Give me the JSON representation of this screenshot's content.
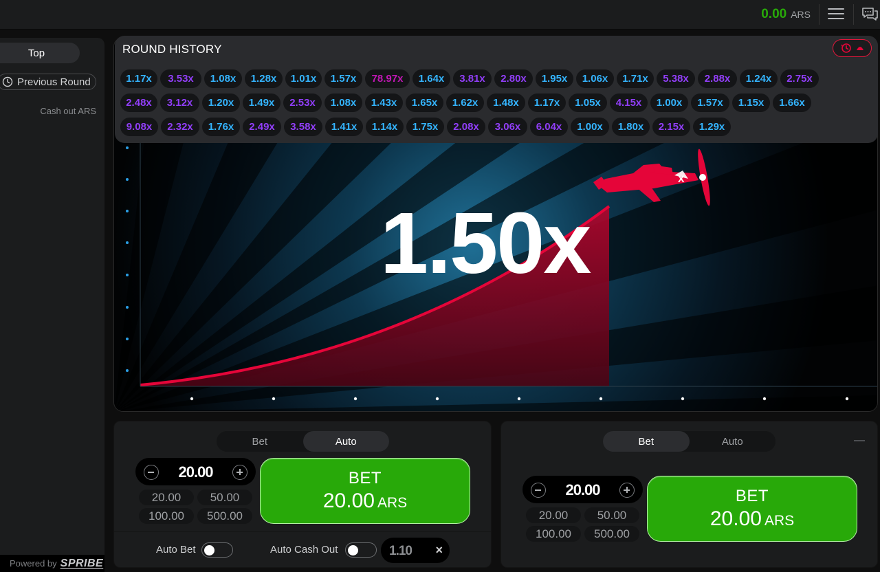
{
  "header": {
    "balance_amount": "0.00",
    "balance_currency": "ARS",
    "menu_icon": "hamburger-menu-icon",
    "chat_icon": "chat-icon"
  },
  "left_panel": {
    "tab_top": "Top",
    "previous_round": "Previous Round",
    "cashout_label": "Cash out ARS",
    "powered_by": "Powered by",
    "brand": "SPRIBE"
  },
  "history": {
    "title": "ROUND HISTORY",
    "rows": [
      [
        {
          "v": "1.17x",
          "c": "blue"
        },
        {
          "v": "3.53x",
          "c": "purple"
        },
        {
          "v": "1.08x",
          "c": "blue"
        },
        {
          "v": "1.28x",
          "c": "blue"
        },
        {
          "v": "1.01x",
          "c": "blue"
        },
        {
          "v": "1.57x",
          "c": "blue"
        },
        {
          "v": "78.97x",
          "c": "pink"
        },
        {
          "v": "1.64x",
          "c": "blue"
        },
        {
          "v": "3.81x",
          "c": "purple"
        },
        {
          "v": "2.80x",
          "c": "purple"
        },
        {
          "v": "1.95x",
          "c": "blue"
        },
        {
          "v": "1.06x",
          "c": "blue"
        },
        {
          "v": "1.71x",
          "c": "blue"
        },
        {
          "v": "5.38x",
          "c": "purple"
        },
        {
          "v": "2.88x",
          "c": "purple"
        },
        {
          "v": "1.24x",
          "c": "blue"
        },
        {
          "v": "2.75x",
          "c": "purple"
        }
      ],
      [
        {
          "v": "2.48x",
          "c": "purple"
        },
        {
          "v": "3.12x",
          "c": "purple"
        },
        {
          "v": "1.20x",
          "c": "blue"
        },
        {
          "v": "1.49x",
          "c": "blue"
        },
        {
          "v": "2.53x",
          "c": "purple"
        },
        {
          "v": "1.08x",
          "c": "blue"
        },
        {
          "v": "1.43x",
          "c": "blue"
        },
        {
          "v": "1.65x",
          "c": "blue"
        },
        {
          "v": "1.62x",
          "c": "blue"
        },
        {
          "v": "1.48x",
          "c": "blue"
        },
        {
          "v": "1.17x",
          "c": "blue"
        },
        {
          "v": "1.05x",
          "c": "blue"
        },
        {
          "v": "4.15x",
          "c": "purple"
        },
        {
          "v": "1.00x",
          "c": "blue"
        },
        {
          "v": "1.57x",
          "c": "blue"
        },
        {
          "v": "1.15x",
          "c": "blue"
        },
        {
          "v": "1.66x",
          "c": "blue"
        }
      ],
      [
        {
          "v": "9.08x",
          "c": "purple"
        },
        {
          "v": "2.32x",
          "c": "purple"
        },
        {
          "v": "1.76x",
          "c": "blue"
        },
        {
          "v": "2.49x",
          "c": "purple"
        },
        {
          "v": "3.58x",
          "c": "purple"
        },
        {
          "v": "1.41x",
          "c": "blue"
        },
        {
          "v": "1.14x",
          "c": "blue"
        },
        {
          "v": "1.75x",
          "c": "blue"
        },
        {
          "v": "2.08x",
          "c": "purple"
        },
        {
          "v": "3.06x",
          "c": "purple"
        },
        {
          "v": "6.04x",
          "c": "purple"
        },
        {
          "v": "1.00x",
          "c": "blue"
        },
        {
          "v": "1.80x",
          "c": "blue"
        },
        {
          "v": "2.15x",
          "c": "purple"
        },
        {
          "v": "1.29x",
          "c": "blue"
        }
      ]
    ]
  },
  "game": {
    "multiplier": "1.50x",
    "accent_color": "#e50539",
    "plane_icon": "airplane-icon"
  },
  "panel1": {
    "tab_bet": "Bet",
    "tab_auto": "Auto",
    "active_tab": "Auto",
    "amount": "20.00",
    "quick": [
      "20.00",
      "50.00",
      "100.00",
      "500.00"
    ],
    "bet_label": "BET",
    "bet_amount": "20.00",
    "bet_currency": "ARS",
    "auto_bet_label": "Auto Bet",
    "auto_cashout_label": "Auto Cash Out",
    "auto_cashout_value": "1.10",
    "clear_glyph": "×"
  },
  "panel2": {
    "tab_bet": "Bet",
    "tab_auto": "Auto",
    "active_tab": "Bet",
    "amount": "20.00",
    "quick": [
      "20.00",
      "50.00",
      "100.00",
      "500.00"
    ],
    "bet_label": "BET",
    "bet_amount": "20.00",
    "bet_currency": "ARS"
  },
  "colors": {
    "green": "#28a909",
    "blue": "#34b4ff",
    "purple": "#913ef8",
    "pink": "#c017b4",
    "red": "#e50539"
  }
}
